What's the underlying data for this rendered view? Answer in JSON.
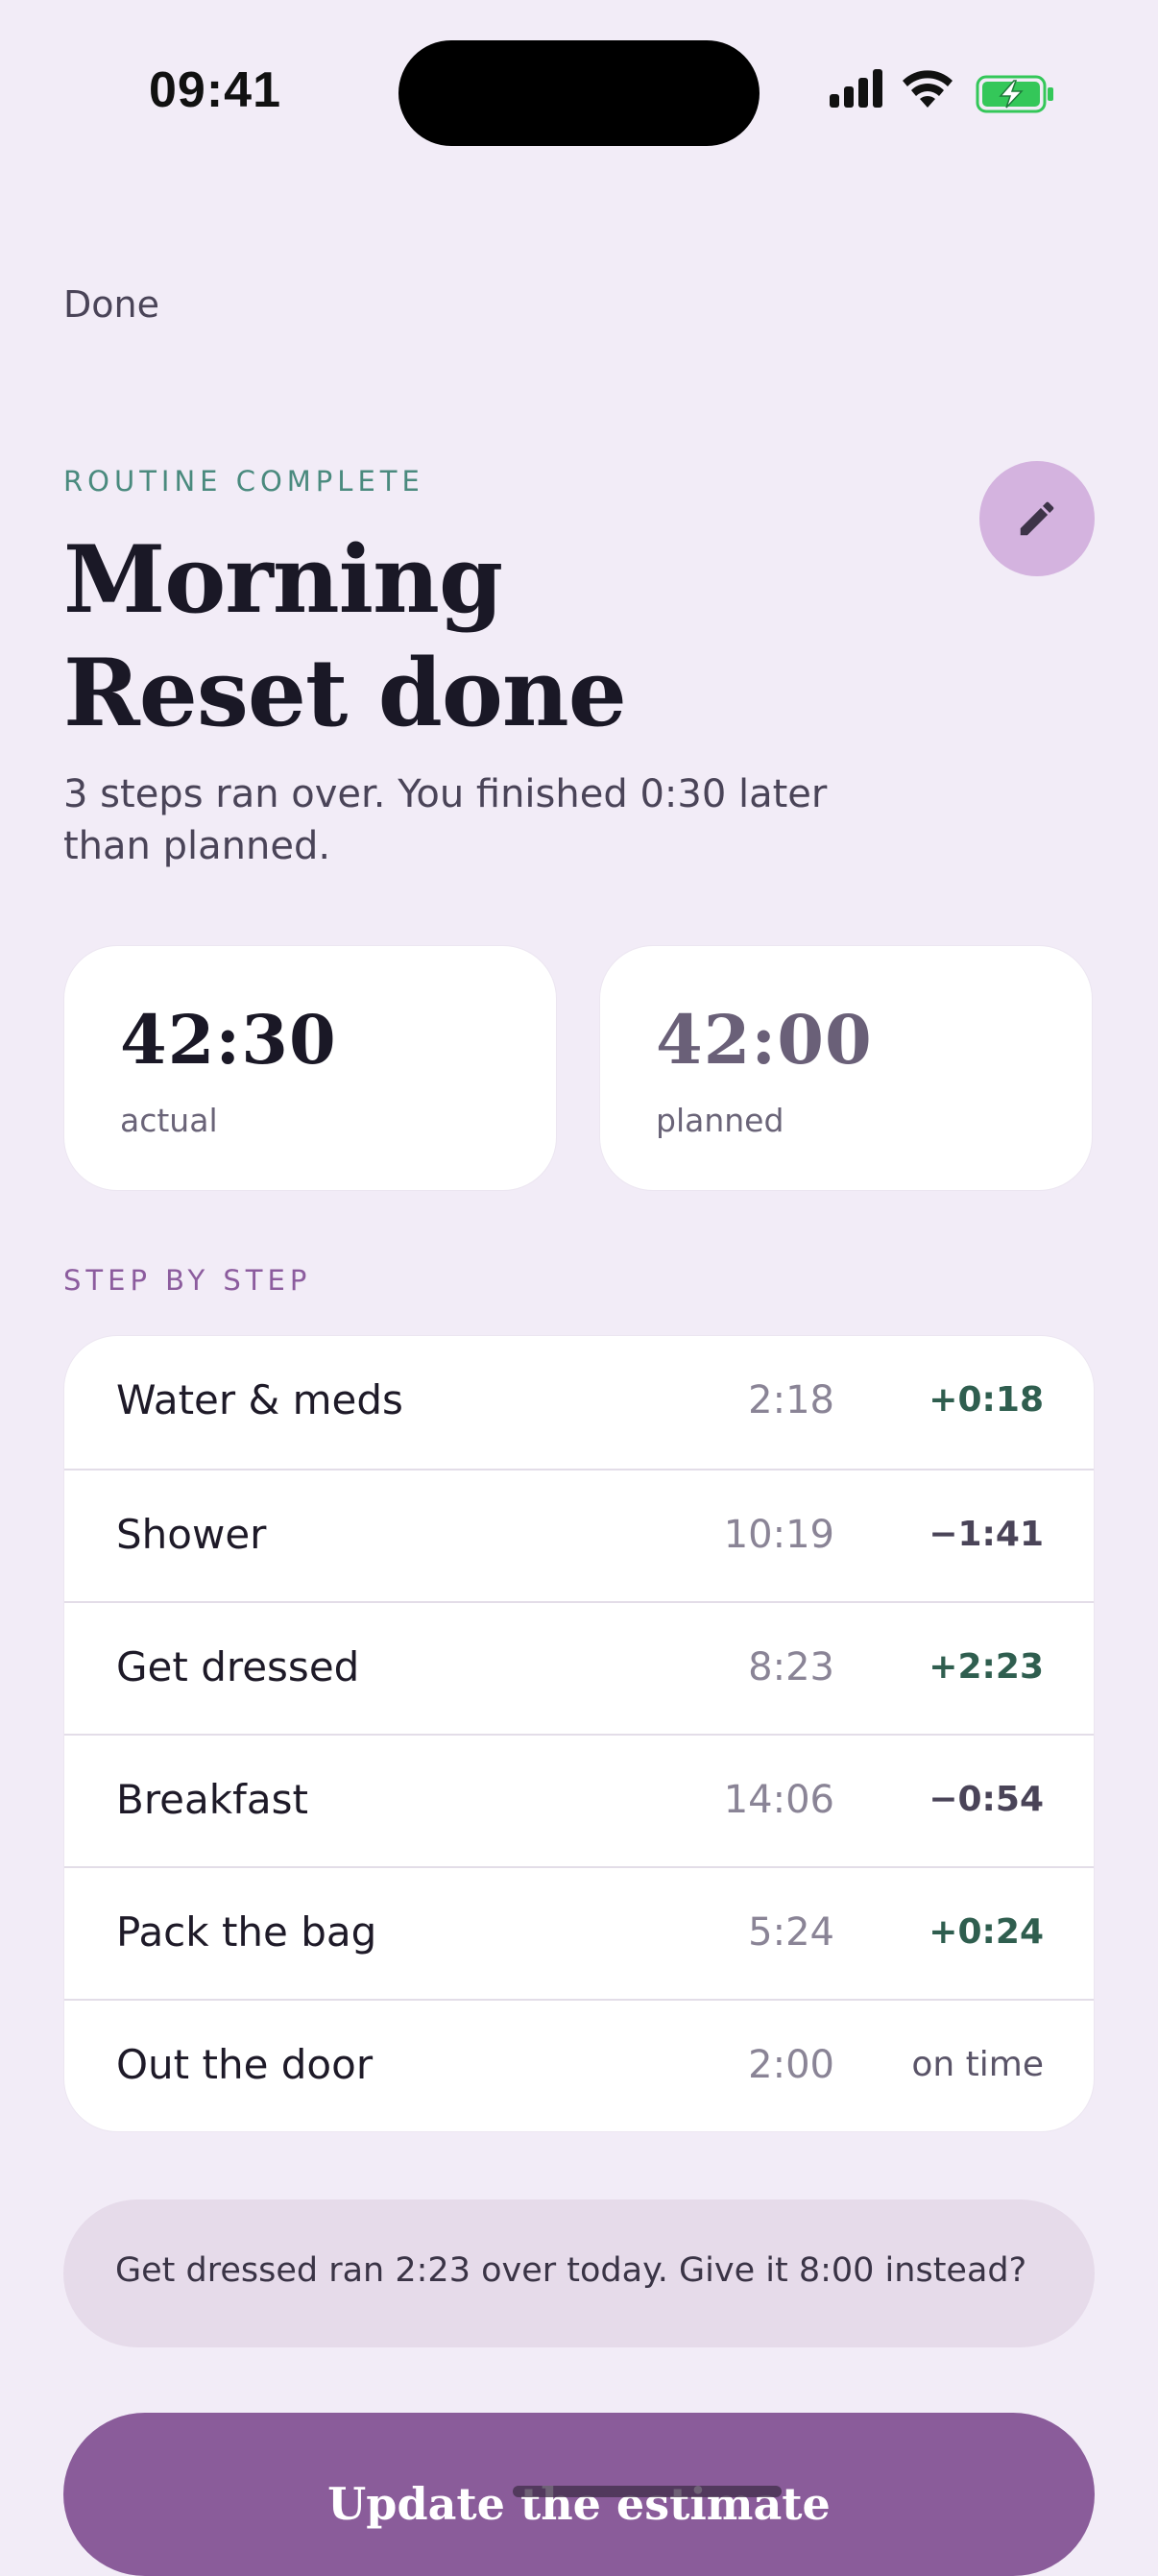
{
  "status_bar": {
    "time": "09:41"
  },
  "nav": {
    "done_label": "Done"
  },
  "header": {
    "eyebrow": "ROUTINE COMPLETE",
    "title_line1": "Morning",
    "title_line2": "Reset done",
    "subtitle": "3 steps ran over. You finished 0:30 later than planned."
  },
  "stats": {
    "actual": {
      "value": "42:30",
      "label": "actual"
    },
    "planned": {
      "value": "42:00",
      "label": "planned"
    }
  },
  "steps_section": {
    "label": "STEP BY STEP",
    "rows": [
      {
        "name": "Water & meds",
        "duration": "2:18",
        "diff": "+0:18",
        "status": "over"
      },
      {
        "name": "Shower",
        "duration": "10:19",
        "diff": "−1:41",
        "status": "under"
      },
      {
        "name": "Get dressed",
        "duration": "8:23",
        "diff": "+2:23",
        "status": "over"
      },
      {
        "name": "Breakfast",
        "duration": "14:06",
        "diff": "−0:54",
        "status": "under"
      },
      {
        "name": "Pack the bag",
        "duration": "5:24",
        "diff": "+0:24",
        "status": "over"
      },
      {
        "name": "Out the door",
        "duration": "2:00",
        "diff": "on time",
        "status": "on-time"
      }
    ]
  },
  "suggestion": {
    "text": "Get dressed ran 2:23 over today. Give it 8:00 instead?"
  },
  "cta": {
    "label": "Update the estimate"
  },
  "colors": {
    "background": "#f2ecf7",
    "accent": "#8a5c9a",
    "over": "#2f5e4f",
    "under": "#4a4458",
    "edit_button": "#d4b3df",
    "battery": "#34c759"
  },
  "icons": {
    "edit": "pencil-icon",
    "signal": "cellular-signal-icon",
    "wifi": "wifi-icon",
    "battery": "battery-charging-icon"
  }
}
